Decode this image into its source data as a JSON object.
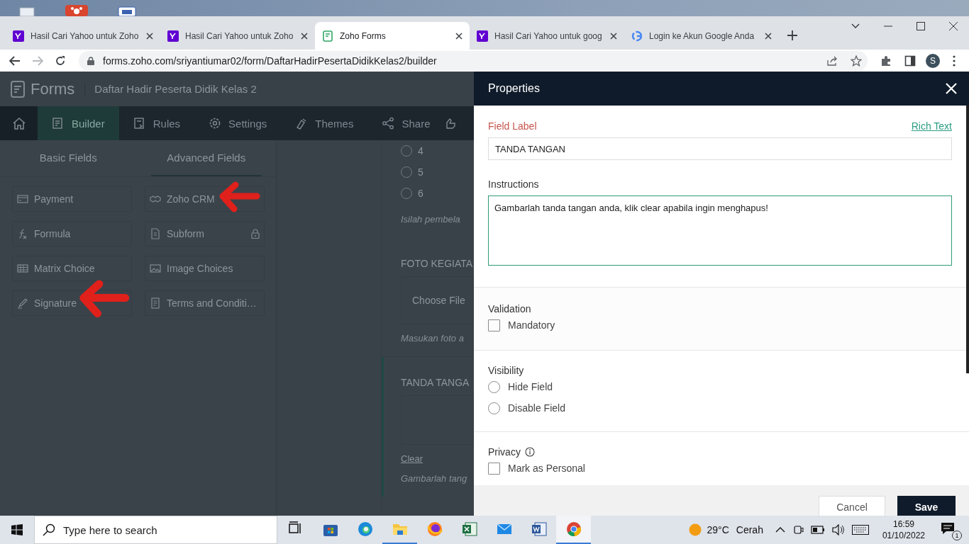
{
  "browser": {
    "tabs": [
      {
        "title": "Hasil Cari Yahoo untuk Zoho",
        "kind": "yahoo",
        "selected": false
      },
      {
        "title": "Hasil Cari Yahoo untuk Zoho",
        "kind": "yahoo",
        "selected": false
      },
      {
        "title": "Zoho Forms",
        "kind": "forms",
        "selected": true
      },
      {
        "title": "Hasil Cari Yahoo untuk goog",
        "kind": "yahoo",
        "selected": false
      },
      {
        "title": "Login ke Akun Google Anda",
        "kind": "google",
        "selected": false
      }
    ],
    "url": "forms.zoho.com/sriyantiumar02/form/DaftarHadirPesertaDidikKelas2/builder",
    "profile": "S"
  },
  "app": {
    "brand": "Forms",
    "form_title": "Daftar Hadir Peserta Didik Kelas 2",
    "nav": [
      {
        "label": "Builder",
        "kind": "builder",
        "selected": true
      },
      {
        "label": "Rules",
        "kind": "rules",
        "selected": false
      },
      {
        "label": "Settings",
        "kind": "settings",
        "selected": false
      },
      {
        "label": "Themes",
        "kind": "themes",
        "selected": false
      },
      {
        "label": "Share",
        "kind": "share",
        "selected": false
      }
    ],
    "field_tabs": [
      {
        "label": "Basic Fields",
        "selected": false
      },
      {
        "label": "Advanced Fields",
        "selected": true
      }
    ],
    "fields": [
      {
        "label": "Payment",
        "kind": "card",
        "locked": false
      },
      {
        "label": "Zoho CRM",
        "kind": "crm",
        "locked": false
      },
      {
        "label": "Formula",
        "kind": "formula",
        "locked": false
      },
      {
        "label": "Subform",
        "kind": "subform",
        "locked": true
      },
      {
        "label": "Matrix Choice",
        "kind": "matrix",
        "locked": false
      },
      {
        "label": "Image Choices",
        "kind": "image",
        "locked": false
      },
      {
        "label": "Signature",
        "kind": "pen",
        "locked": false
      },
      {
        "label": "Terms and Conditi…",
        "kind": "doc",
        "locked": false
      }
    ],
    "canvas": {
      "choices": [
        {
          "label": "4",
          "selected": false
        },
        {
          "label": "5",
          "selected": false
        },
        {
          "label": "6",
          "selected": false
        }
      ],
      "choices_hint": "Isilah pembela",
      "fields": [
        {
          "kind": "file",
          "label": "FOTO KEGIATA",
          "button": "Choose File",
          "hint": "Masukan foto a",
          "selected": false
        },
        {
          "kind": "signature",
          "label": "TANDA TANGA",
          "clear": "Clear",
          "hint": "Gambarlah tang",
          "selected": true
        }
      ]
    }
  },
  "properties": {
    "title": "Properties",
    "field_label": {
      "label": "Field Label",
      "value": "TANDA TANGAN"
    },
    "rich_text": "Rich Text",
    "instructions": {
      "label": "Instructions",
      "value": "Gambarlah tanda tangan anda, klik clear apabila ingin menghapus!"
    },
    "sections": [
      {
        "title": "Validation",
        "info": false,
        "options": [
          {
            "kind": "checkbox",
            "label": "Mandatory",
            "checked": false
          }
        ]
      },
      {
        "title": "Visibility",
        "info": false,
        "options": [
          {
            "kind": "radio",
            "label": "Hide Field",
            "selected": false
          },
          {
            "kind": "radio",
            "label": "Disable Field",
            "selected": false
          }
        ]
      },
      {
        "title": "Privacy",
        "info": true,
        "options": [
          {
            "kind": "checkbox",
            "label": "Mark as Personal",
            "checked": false
          }
        ]
      }
    ],
    "buttons": [
      {
        "label": "Cancel",
        "kind": "secondary"
      },
      {
        "label": "Save",
        "kind": "primary"
      }
    ]
  },
  "taskbar": {
    "search_placeholder": "Type here to search",
    "apps": [
      {
        "kind": "taskview",
        "running": false,
        "active": false
      },
      {
        "kind": "store",
        "running": false,
        "active": false
      },
      {
        "kind": "edge",
        "running": false,
        "active": false
      },
      {
        "kind": "folder",
        "running": true,
        "active": false
      },
      {
        "kind": "firefox",
        "running": false,
        "active": false
      },
      {
        "kind": "excel",
        "running": false,
        "active": false
      },
      {
        "kind": "mail",
        "running": false,
        "active": false
      },
      {
        "kind": "word",
        "running": false,
        "active": false
      },
      {
        "kind": "chrome",
        "running": true,
        "active": true
      }
    ],
    "weather": {
      "temp": "29°C",
      "condition": "Cerah"
    },
    "time": "16:59",
    "date": "01/10/2022",
    "notifications": "1"
  }
}
